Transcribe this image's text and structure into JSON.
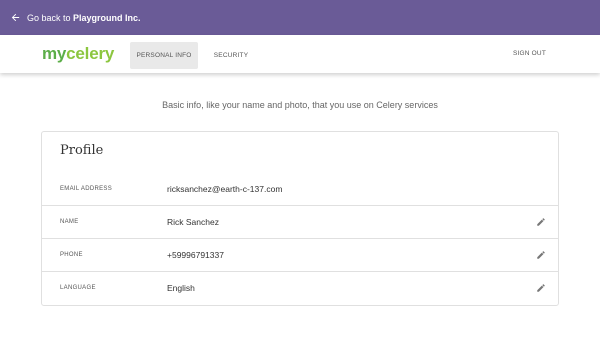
{
  "topbar": {
    "back_prefix": "Go back to",
    "back_org": "Playground Inc."
  },
  "brand": {
    "part1": "my",
    "part2": "celery"
  },
  "nav": {
    "tabs": [
      {
        "label": "PERSONAL INFO",
        "active": true
      },
      {
        "label": "SECURITY",
        "active": false
      }
    ],
    "signout_label": "SIGN OUT"
  },
  "subtitle": "Basic info, like your name and photo, that you use on Celery services",
  "profile": {
    "title": "Profile",
    "rows": [
      {
        "label": "EMAIL ADDRESS",
        "value": "ricksanchez@earth-c-137.com",
        "editable": false
      },
      {
        "label": "NAME",
        "value": "Rick Sanchez",
        "editable": true
      },
      {
        "label": "PHONE",
        "value": "+59996791337",
        "editable": true
      },
      {
        "label": "LANGUAGE",
        "value": "English",
        "editable": true
      }
    ]
  },
  "colors": {
    "topbar_bg": "#6a5b97",
    "brand_green_dark": "#5cae49",
    "brand_green_light": "#8cc63f"
  },
  "icons": {
    "back": "arrow-left-icon",
    "edit": "pencil-icon"
  }
}
